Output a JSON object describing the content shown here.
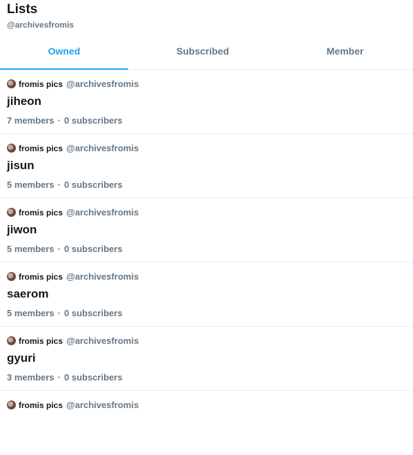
{
  "header": {
    "title": "Lists",
    "handle": "@archivesfromis"
  },
  "tabs": [
    {
      "label": "Owned",
      "active": true
    },
    {
      "label": "Subscribed",
      "active": false
    },
    {
      "label": "Member",
      "active": false
    }
  ],
  "colors": {
    "accent": "#1da1f2",
    "secondary_text": "#657786",
    "divider": "#e6ecf0"
  },
  "lists": [
    {
      "owner_name": "fromis pics",
      "owner_handle": "@archivesfromis",
      "name": "jiheon",
      "members": "7 members",
      "separator": "·",
      "subscribers": "0 subscribers"
    },
    {
      "owner_name": "fromis pics",
      "owner_handle": "@archivesfromis",
      "name": "jisun",
      "members": "5 members",
      "separator": "·",
      "subscribers": "0 subscribers"
    },
    {
      "owner_name": "fromis pics",
      "owner_handle": "@archivesfromis",
      "name": "jiwon",
      "members": "5 members",
      "separator": "·",
      "subscribers": "0 subscribers"
    },
    {
      "owner_name": "fromis pics",
      "owner_handle": "@archivesfromis",
      "name": "saerom",
      "members": "5 members",
      "separator": "·",
      "subscribers": "0 subscribers"
    },
    {
      "owner_name": "fromis pics",
      "owner_handle": "@archivesfromis",
      "name": "gyuri",
      "members": "3 members",
      "separator": "·",
      "subscribers": "0 subscribers"
    },
    {
      "owner_name": "fromis pics",
      "owner_handle": "@archivesfromis"
    }
  ]
}
